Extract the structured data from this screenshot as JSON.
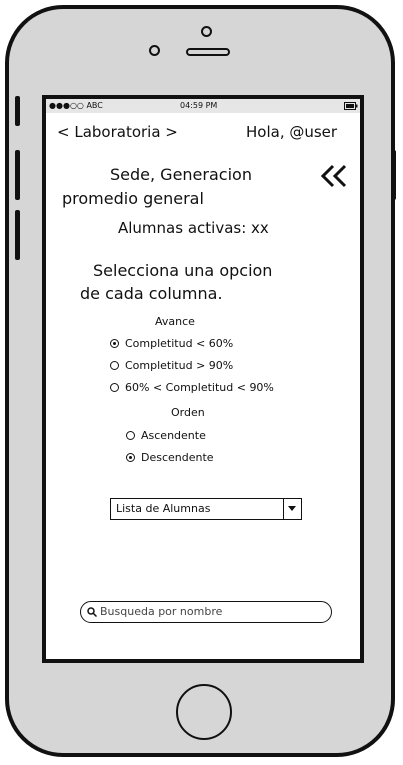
{
  "status_bar": {
    "carrier": "●●●○○ ABC",
    "time": "04:59 PM"
  },
  "header": {
    "back_label": "< Laboratoria >",
    "greeting": "Hola, @user"
  },
  "summary": {
    "line1": "Sede, Generacion",
    "line2": "promedio general",
    "active_students": "Alumnas activas: xx"
  },
  "collapse_icon": "double-chevron-left",
  "instructions": {
    "line1": "Selecciona una opcion",
    "line2": "de cada columna."
  },
  "avance": {
    "heading": "Avance",
    "options": [
      {
        "label": "Completitud < 60%",
        "selected": true
      },
      {
        "label": "Completitud > 90%",
        "selected": false
      },
      {
        "label": "60% < Completitud < 90%",
        "selected": false
      }
    ]
  },
  "orden": {
    "heading": "Orden",
    "options": [
      {
        "label": "Ascendente",
        "selected": false
      },
      {
        "label": "Descendente",
        "selected": true
      }
    ]
  },
  "list_select": {
    "value": "Lista de Alumnas"
  },
  "search": {
    "placeholder": "Busqueda por nombre"
  }
}
